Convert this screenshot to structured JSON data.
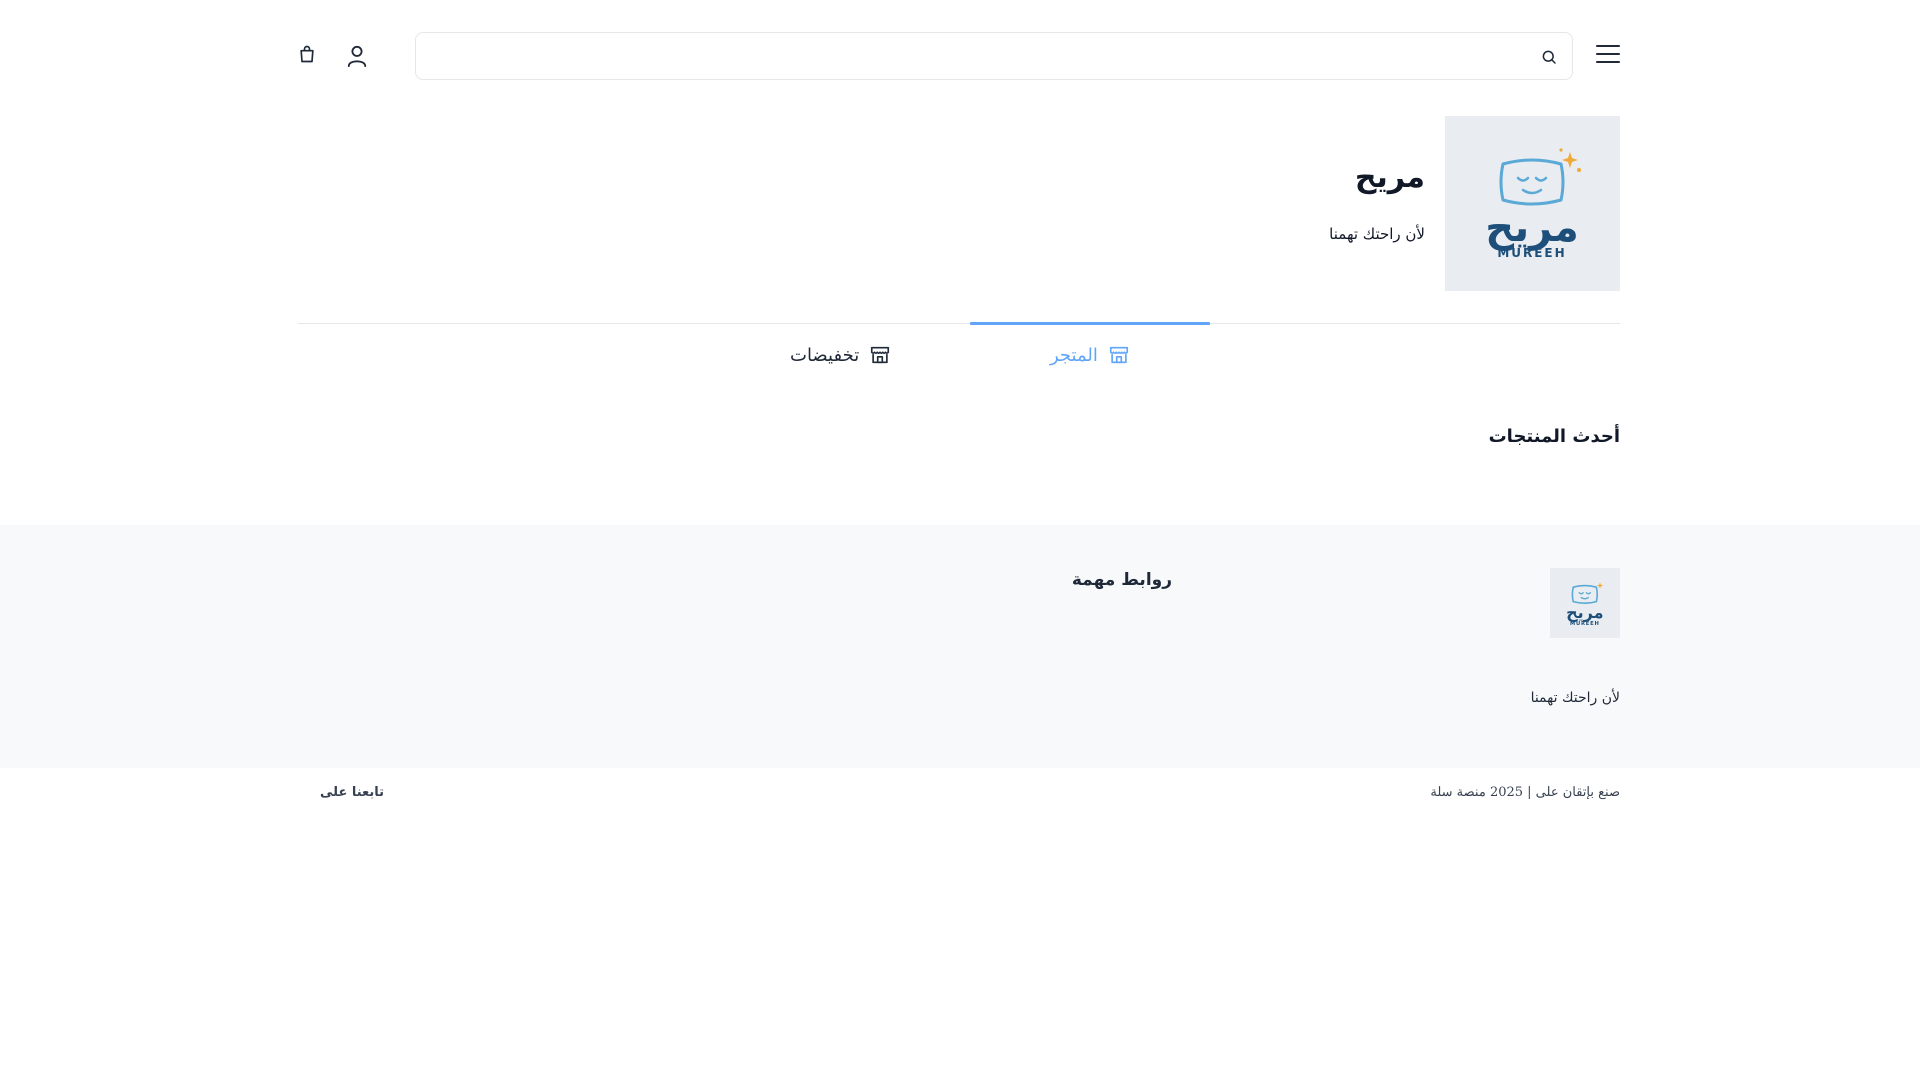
{
  "header": {
    "search_placeholder": "",
    "icons": {
      "menu": "hamburger-menu-icon",
      "search": "search-icon",
      "user": "user-icon",
      "cart": "shopping-bag-icon"
    }
  },
  "store": {
    "name": "مريح",
    "tagline": "لأن راحتك تهمنا",
    "logo": {
      "arabic_text": "مريح",
      "latin_text": "MUREEH"
    }
  },
  "tabs": [
    {
      "label": "المتجر",
      "icon": "storefront-icon",
      "active": true
    },
    {
      "label": "تخفيضات",
      "icon": "storefront-icon",
      "active": false
    }
  ],
  "sections": {
    "latest_products": "أحدث المنتجات"
  },
  "footer": {
    "links_title": "روابط مهمة",
    "tagline": "لأن راحتك تهمنا",
    "copyright": "صنع بإتقان على | 2025 منصة سلة",
    "follow_us": "تابعنا على"
  },
  "colors": {
    "accent": "#60a5fa",
    "logo_navy": "#1e4f7a",
    "logo_light_blue": "#5aa9d6",
    "logo_star": "#f0a93b",
    "footer_bg": "#f8f9fb"
  }
}
